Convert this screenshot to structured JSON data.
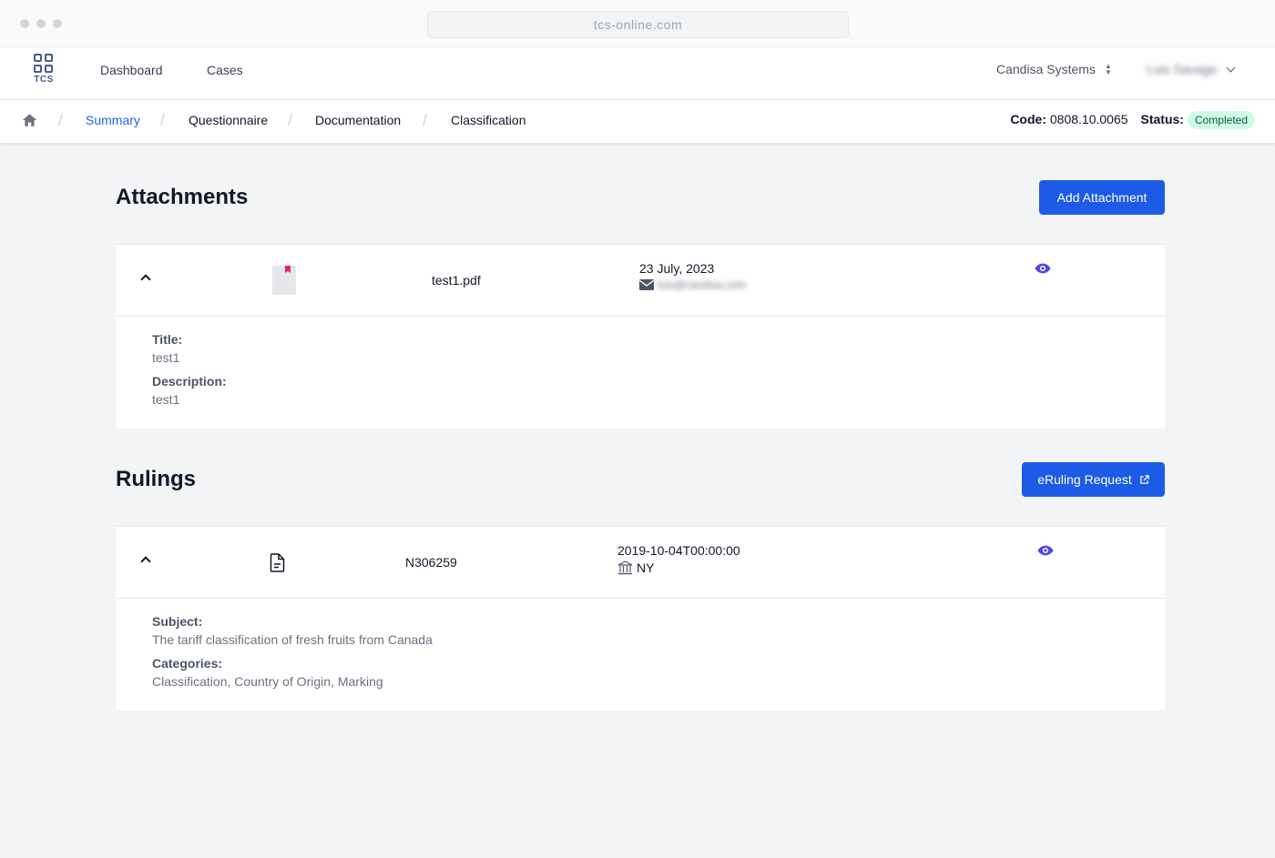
{
  "browser": {
    "url": "tcs-online.com"
  },
  "header": {
    "logo_text": "TCS",
    "nav": [
      {
        "label": "Dashboard"
      },
      {
        "label": "Cases"
      }
    ],
    "org_select": "Candisa Systems",
    "user_name": "Luis Savage"
  },
  "subnav": {
    "crumbs": [
      {
        "label": "Summary",
        "active": true
      },
      {
        "label": "Questionnaire"
      },
      {
        "label": "Documentation"
      },
      {
        "label": "Classification"
      }
    ],
    "code_label": "Code:",
    "code_value": "0808.10.0065",
    "status_label": "Status:",
    "status_value": "Completed"
  },
  "attachments": {
    "title": "Attachments",
    "add_button": "Add Attachment",
    "items": [
      {
        "filename": "test1.pdf",
        "date": "23 July, 2023",
        "email": "luis@candisa.com",
        "title_label": "Title:",
        "title_value": "test1",
        "description_label": "Description:",
        "description_value": "test1"
      }
    ]
  },
  "rulings": {
    "title": "Rulings",
    "request_button": "eRuling Request",
    "items": [
      {
        "number": "N306259",
        "date": "2019-10-04T00:00:00",
        "office": "NY",
        "subject_label": "Subject:",
        "subject_value": "The tariff classification of fresh fruits from Canada",
        "categories_label": "Categories:",
        "categories_value": "Classification, Country of Origin, Marking"
      }
    ]
  },
  "colors": {
    "primary": "#1d5be6",
    "link": "#2563eb",
    "eye": "#4f46e5",
    "badge_bg": "#d1fae5",
    "badge_text": "#065f46"
  }
}
